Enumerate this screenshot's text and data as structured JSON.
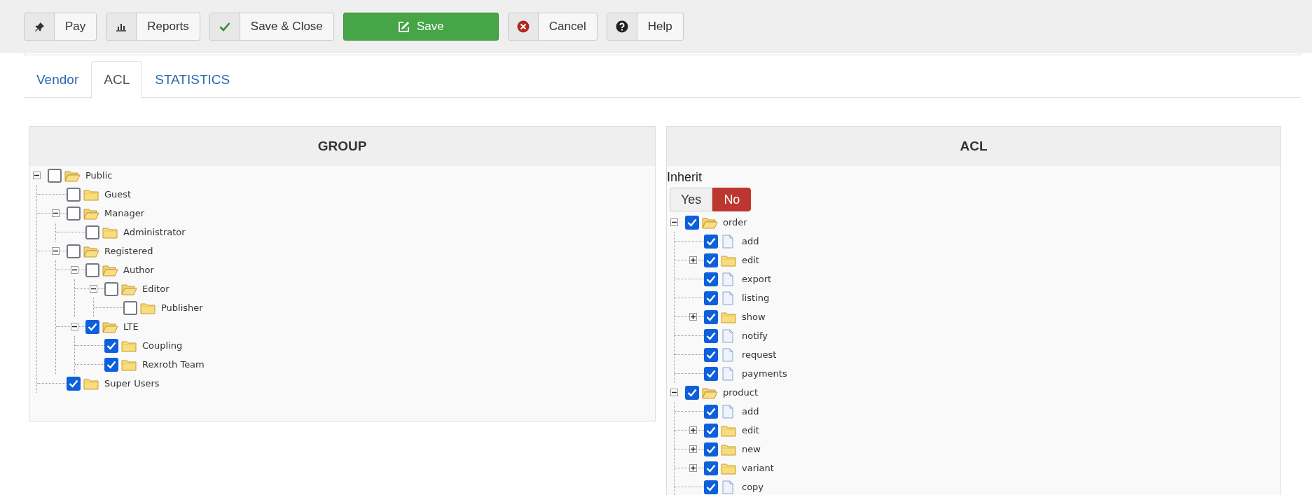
{
  "toolbar": {
    "buttons": [
      {
        "label": "Pay",
        "kind": "default"
      },
      {
        "label": "Reports",
        "kind": "default"
      },
      {
        "label": "Save & Close",
        "kind": "default"
      },
      {
        "label": "Save",
        "kind": "primary"
      },
      {
        "label": "Cancel",
        "kind": "default"
      },
      {
        "label": "Help",
        "kind": "default"
      }
    ]
  },
  "tabs": [
    {
      "label": "Vendor",
      "selected": false
    },
    {
      "label": "ACL",
      "selected": true
    },
    {
      "label": "STATISTICS",
      "selected": false
    }
  ],
  "group_panel": {
    "title": "GROUP",
    "tree": [
      {
        "label": "Public",
        "kind": "folder",
        "checked": false,
        "expanded": true,
        "children": [
          {
            "label": "Guest",
            "kind": "folder",
            "checked": false
          },
          {
            "label": "Manager",
            "kind": "folder",
            "checked": false,
            "expanded": true,
            "children": [
              {
                "label": "Administrator",
                "kind": "folder",
                "checked": false
              }
            ]
          },
          {
            "label": "Registered",
            "kind": "folder",
            "checked": false,
            "expanded": true,
            "children": [
              {
                "label": "Author",
                "kind": "folder",
                "checked": false,
                "expanded": true,
                "children": [
                  {
                    "label": "Editor",
                    "kind": "folder",
                    "checked": false,
                    "expanded": true,
                    "children": [
                      {
                        "label": "Publisher",
                        "kind": "folder",
                        "checked": false
                      }
                    ]
                  }
                ]
              },
              {
                "label": "LTE",
                "kind": "folder",
                "checked": true,
                "expanded": true,
                "children": [
                  {
                    "label": "Coupling",
                    "kind": "folder",
                    "checked": true
                  },
                  {
                    "label": "Rexroth Team",
                    "kind": "folder",
                    "checked": true
                  }
                ]
              }
            ]
          },
          {
            "label": "Super Users",
            "kind": "folder",
            "checked": true
          }
        ]
      }
    ]
  },
  "acl_panel": {
    "title": "ACL",
    "inherit": {
      "label": "Inherit",
      "options": [
        {
          "label": "Yes",
          "selected": false
        },
        {
          "label": "No",
          "selected": true
        }
      ]
    },
    "tree": [
      {
        "label": "order",
        "kind": "folder",
        "checked": true,
        "expanded": true,
        "children": [
          {
            "label": "add",
            "kind": "file",
            "checked": true
          },
          {
            "label": "edit",
            "kind": "folder",
            "checked": true,
            "expanded": false
          },
          {
            "label": "export",
            "kind": "file",
            "checked": true
          },
          {
            "label": "listing",
            "kind": "file",
            "checked": true
          },
          {
            "label": "show",
            "kind": "folder",
            "checked": true,
            "expanded": false
          },
          {
            "label": "notify",
            "kind": "file",
            "checked": true
          },
          {
            "label": "request",
            "kind": "file",
            "checked": true
          },
          {
            "label": "payments",
            "kind": "file",
            "checked": true
          }
        ]
      },
      {
        "label": "product",
        "kind": "folder",
        "checked": true,
        "expanded": true,
        "children": [
          {
            "label": "add",
            "kind": "file",
            "checked": true
          },
          {
            "label": "edit",
            "kind": "folder",
            "checked": true,
            "expanded": false
          },
          {
            "label": "new",
            "kind": "folder",
            "checked": true,
            "expanded": false
          },
          {
            "label": "variant",
            "kind": "folder",
            "checked": true,
            "expanded": false
          },
          {
            "label": "copy",
            "kind": "file",
            "checked": true
          }
        ]
      }
    ]
  }
}
